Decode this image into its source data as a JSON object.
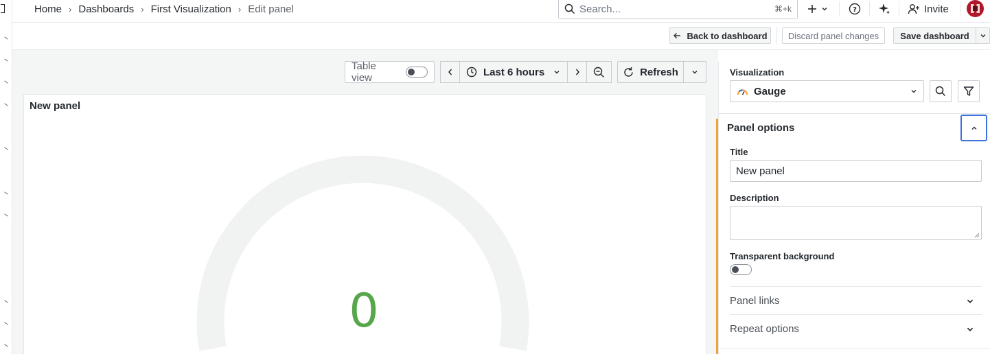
{
  "breadcrumb": {
    "items": [
      "Home",
      "Dashboards",
      "First Visualization"
    ],
    "current": "Edit panel"
  },
  "search": {
    "placeholder": "Search...",
    "shortcut": "⌘+k"
  },
  "topbar": {
    "invite_label": "Invite"
  },
  "toolbar": {
    "back_label": "Back to dashboard",
    "discard_label": "Discard panel changes",
    "save_label": "Save dashboard"
  },
  "editor": {
    "table_view_label": "Table view",
    "table_view_enabled": false,
    "time_range_label": "Last 6 hours",
    "refresh_label": "Refresh"
  },
  "panel": {
    "title": "New panel",
    "gauge_value": "0",
    "gauge_color": "#56a64b"
  },
  "options": {
    "visualization_label": "Visualization",
    "visualization_value": "Gauge",
    "panel_options_title": "Panel options",
    "title_label": "Title",
    "title_value": "New panel",
    "description_label": "Description",
    "description_value": "",
    "transparent_label": "Transparent background",
    "transparent_enabled": false,
    "panel_links_title": "Panel links",
    "repeat_options_title": "Repeat options"
  },
  "colors": {
    "accent_orange": "#f5a034",
    "focus_blue": "#3d71d9",
    "gauge_green": "#56a64b"
  }
}
